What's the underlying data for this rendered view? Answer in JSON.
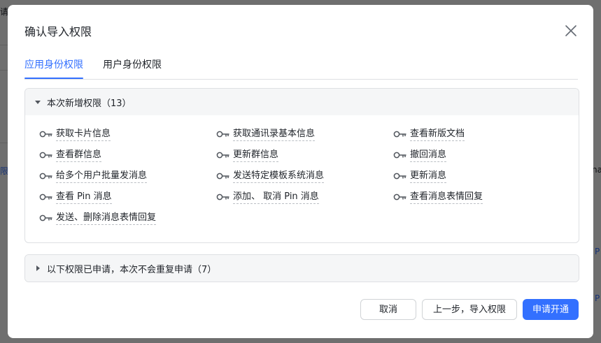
{
  "background": {
    "fragments": [
      "请",
      "限",
      "na",
      "P",
      "P"
    ]
  },
  "dialog": {
    "title": "确认导入权限",
    "tabs": [
      {
        "label": "应用身份权限",
        "active": true
      },
      {
        "label": "用户身份权限",
        "active": false
      }
    ],
    "new_section": {
      "title": "本次新增权限（13）",
      "expanded": true,
      "permissions": [
        "获取卡片信息",
        "获取通讯录基本信息",
        "查看新版文档",
        "查看群信息",
        "更新群信息",
        "撤回消息",
        "给多个用户批量发消息",
        "发送特定模板系统消息",
        "更新消息",
        "查看 Pin 消息",
        "添加、 取消 Pin 消息",
        "查看消息表情回复",
        "发送、删除消息表情回复"
      ]
    },
    "applied_section": {
      "title": "以下权限已申请，本次不会重复申请（7）",
      "expanded": false
    },
    "buttons": {
      "cancel": "取消",
      "back": "上一步，导入权限",
      "submit": "申请开通"
    }
  },
  "colors": {
    "accent": "#3370ff",
    "text": "#1f2329",
    "border": "#dee0e3",
    "panel_head": "#f5f6f7"
  },
  "icons": {
    "close": "close-icon",
    "caret_down": "caret-down-icon",
    "caret_right": "caret-right-icon",
    "permission": "key-icon"
  }
}
